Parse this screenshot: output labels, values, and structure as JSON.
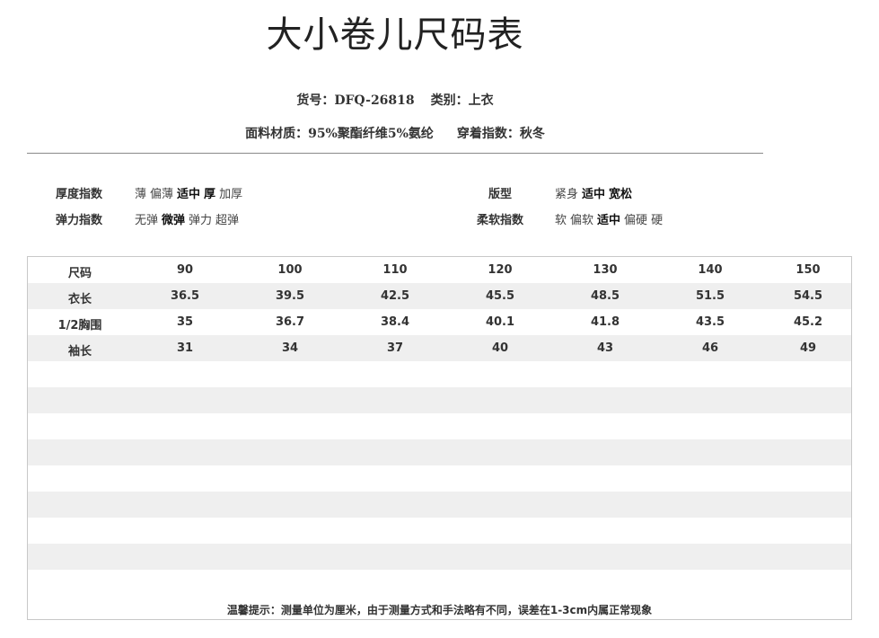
{
  "title": "大小卷儿尺码表",
  "meta": {
    "item_no_label": "货号：",
    "item_no": "DFQ-26818",
    "category_label": "类别：",
    "category": "上衣",
    "fabric_label": "面料材质：",
    "fabric": "95%聚酯纤维5%氨纶",
    "season_label": "穿着指数：",
    "season": "秋冬"
  },
  "attributes": {
    "thickness": {
      "label": "厚度指数",
      "options": [
        "薄",
        "偏薄",
        "适中",
        "厚",
        "加厚"
      ],
      "selected": [
        "适中",
        "厚"
      ]
    },
    "elasticity": {
      "label": "弹力指数",
      "options": [
        "无弹",
        "微弹",
        "弹力",
        "超弹"
      ],
      "selected": [
        "微弹"
      ]
    },
    "fit": {
      "label": "版型",
      "options": [
        "紧身",
        "适中",
        "宽松"
      ],
      "selected": [
        "适中",
        "宽松"
      ]
    },
    "softness": {
      "label": "柔软指数",
      "options": [
        "软",
        "偏软",
        "适中",
        "偏硬",
        "硬"
      ],
      "selected": [
        "适中"
      ]
    }
  },
  "size_table": {
    "headers": [
      "尺码",
      "90",
      "100",
      "110",
      "120",
      "130",
      "140",
      "150"
    ],
    "rows": [
      [
        "衣长",
        "36.5",
        "39.5",
        "42.5",
        "45.5",
        "48.5",
        "51.5",
        "54.5"
      ],
      [
        "1/2胸围",
        "35",
        "36.7",
        "38.4",
        "40.1",
        "41.8",
        "43.5",
        "45.2"
      ],
      [
        "袖长",
        "31",
        "34",
        "37",
        "40",
        "43",
        "46",
        "49"
      ]
    ],
    "empty_rows": 9
  },
  "tip": "温馨提示：测量单位为厘米，由于测量方式和手法略有不同，误差在1-3cm内属正常现象"
}
